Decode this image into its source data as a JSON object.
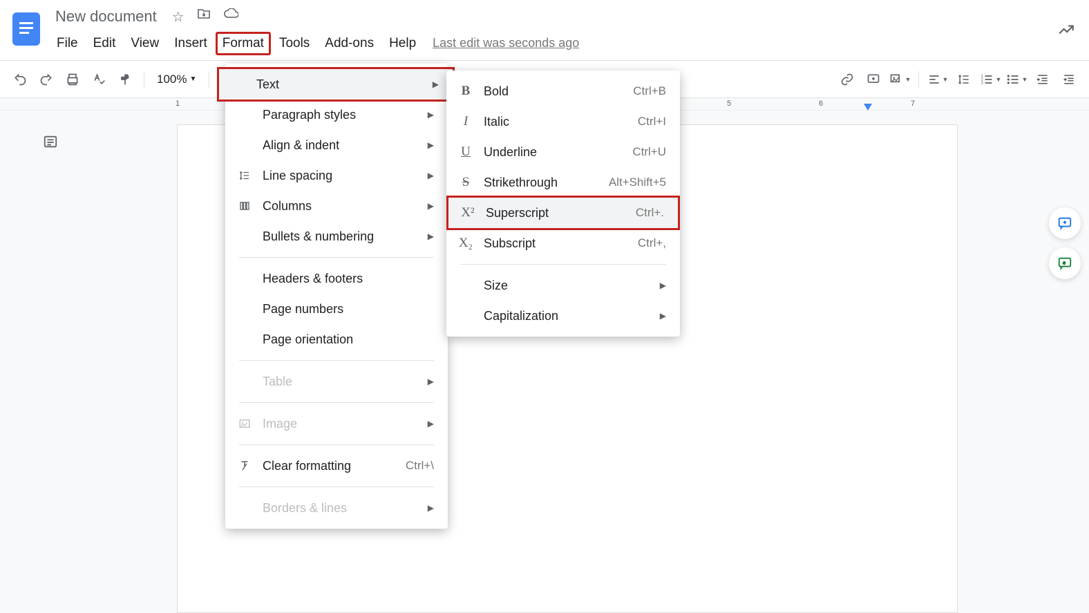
{
  "header": {
    "doc_title": "New document",
    "menubar": [
      "File",
      "Edit",
      "View",
      "Insert",
      "Format",
      "Tools",
      "Add-ons",
      "Help"
    ],
    "active_menu_index": 4,
    "last_edit": "Last edit was seconds ago"
  },
  "toolbar": {
    "zoom": "100%"
  },
  "ruler": {
    "marks": [
      "1",
      "5",
      "6",
      "7"
    ]
  },
  "format_menu": {
    "items": [
      {
        "label": "Text",
        "icon": "",
        "arrow": true,
        "hover": true,
        "highlight": true
      },
      {
        "label": "Paragraph styles",
        "icon": "",
        "arrow": true
      },
      {
        "label": "Align & indent",
        "icon": "",
        "arrow": true
      },
      {
        "label": "Line spacing",
        "icon": "line-spacing",
        "arrow": true
      },
      {
        "label": "Columns",
        "icon": "columns",
        "arrow": true
      },
      {
        "label": "Bullets & numbering",
        "icon": "",
        "arrow": true
      },
      {
        "sep": true
      },
      {
        "label": "Headers & footers",
        "icon": ""
      },
      {
        "label": "Page numbers",
        "icon": ""
      },
      {
        "label": "Page orientation",
        "icon": ""
      },
      {
        "sep": true
      },
      {
        "label": "Table",
        "icon": "",
        "arrow": true,
        "disabled": true
      },
      {
        "sep": true
      },
      {
        "label": "Image",
        "icon": "image",
        "arrow": true,
        "disabled": true
      },
      {
        "sep": true
      },
      {
        "label": "Clear formatting",
        "icon": "clear",
        "shortcut": "Ctrl+\\"
      },
      {
        "sep": true
      },
      {
        "label": "Borders & lines",
        "icon": "",
        "arrow": true,
        "disabled": true
      }
    ]
  },
  "text_submenu": {
    "items": [
      {
        "label": "Bold",
        "icon": "B",
        "shortcut": "Ctrl+B",
        "bold": true
      },
      {
        "label": "Italic",
        "icon": "I",
        "shortcut": "Ctrl+I",
        "italic": true
      },
      {
        "label": "Underline",
        "icon": "U",
        "shortcut": "Ctrl+U",
        "underline": true
      },
      {
        "label": "Strikethrough",
        "icon": "S",
        "shortcut": "Alt+Shift+5",
        "strike": true
      },
      {
        "label": "Superscript",
        "icon": "X²",
        "shortcut": "Ctrl+.",
        "hover": true,
        "highlight": true
      },
      {
        "label": "Subscript",
        "icon": "X₂",
        "shortcut": "Ctrl+,"
      },
      {
        "sep": true
      },
      {
        "label": "Size",
        "icon": "",
        "arrow": true
      },
      {
        "label": "Capitalization",
        "icon": "",
        "arrow": true
      }
    ]
  }
}
